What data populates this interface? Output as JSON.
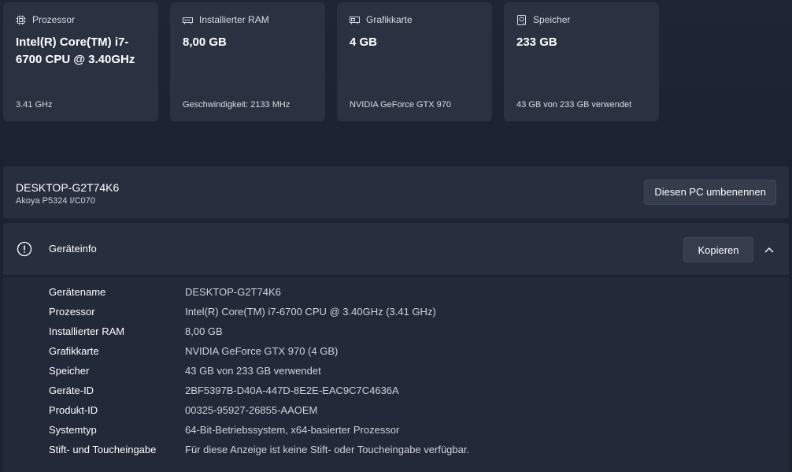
{
  "cards": [
    {
      "title": "Prozessor",
      "icon": "processor-icon",
      "value": "Intel(R) Core(TM) i7-6700 CPU @ 3.40GHz",
      "sub": "3.41 GHz"
    },
    {
      "title": "Installierter RAM",
      "icon": "ram-icon",
      "value": "8,00 GB",
      "sub": "Geschwindigkeit: 2133 MHz"
    },
    {
      "title": "Grafikkarte",
      "icon": "graphics-card-icon",
      "value": "4 GB",
      "sub": "NVIDIA GeForce GTX 970"
    },
    {
      "title": "Speicher",
      "icon": "storage-icon",
      "value": "233 GB",
      "sub": "43 GB von 233 GB verwendet"
    }
  ],
  "device": {
    "name": "DESKTOP-G2T74K6",
    "model": "Akoya P5324 I/C070",
    "rename_label": "Diesen PC umbenennen"
  },
  "info": {
    "title": "Geräteinfo",
    "copy_label": "Kopieren",
    "rows": [
      {
        "label": "Gerätename",
        "value": "DESKTOP-G2T74K6"
      },
      {
        "label": "Prozessor",
        "value": "Intel(R) Core(TM) i7-6700 CPU @ 3.40GHz (3.41 GHz)"
      },
      {
        "label": "Installierter RAM",
        "value": "8,00 GB"
      },
      {
        "label": "Grafikkarte",
        "value": "NVIDIA GeForce GTX 970 (4 GB)"
      },
      {
        "label": "Speicher",
        "value": "43 GB von 233 GB verwendet"
      },
      {
        "label": "Geräte-ID",
        "value": "2BF5397B-D40A-447D-8E2E-EAC9C7C4636A"
      },
      {
        "label": "Produkt-ID",
        "value": "00325-95927-26855-AAOEM"
      },
      {
        "label": "Systemtyp",
        "value": "64-Bit-Betriebssystem, x64-basierter Prozessor"
      },
      {
        "label": "Stift- und Toucheingabe",
        "value": "Für diese Anzeige ist keine Stift- oder Toucheingabe verfügbar."
      }
    ]
  },
  "colors": {
    "background": "#1c2333",
    "card": "#2a3242",
    "panel": "#272e3d",
    "button": "#353c4b",
    "text_secondary": "#cfd3db"
  }
}
